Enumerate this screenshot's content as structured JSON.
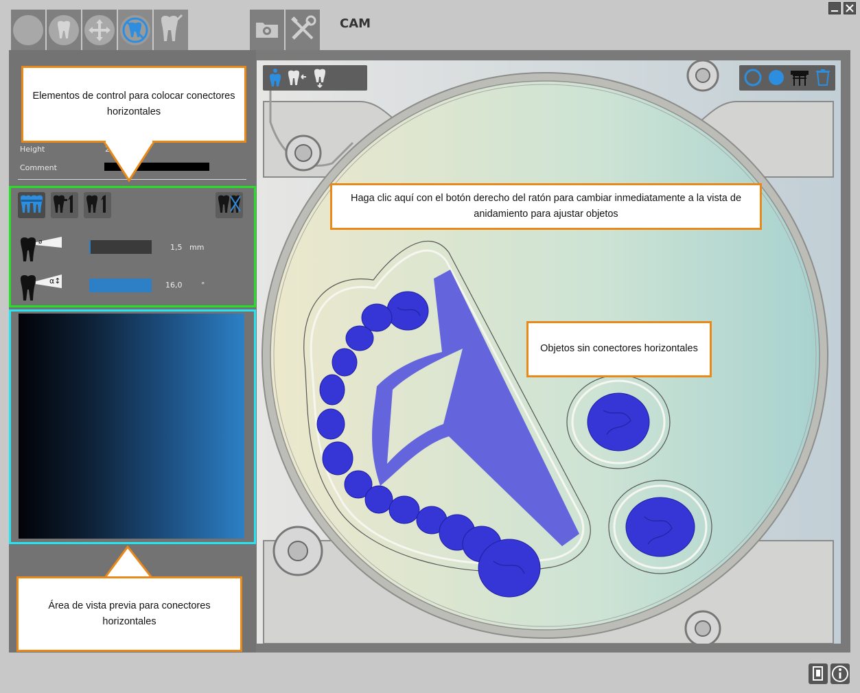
{
  "app": {
    "title": "CAM"
  },
  "toolbar": {
    "tabs": [
      {
        "icon": "circle-icon"
      },
      {
        "icon": "tooth-icon"
      },
      {
        "icon": "move-arrows-icon"
      },
      {
        "icon": "tooth-connector-icon",
        "active": true
      },
      {
        "icon": "tooth-brush-icon"
      }
    ],
    "extra": [
      {
        "icon": "settings-folder-icon"
      },
      {
        "icon": "tools-icon"
      }
    ]
  },
  "properties": {
    "height_label": "Height",
    "height_value": "20",
    "comment_label": "Comment"
  },
  "connector_controls": {
    "buttons": [
      {
        "icon": "connector-all-icon",
        "active": true
      },
      {
        "icon": "connector-single-icon"
      },
      {
        "icon": "connector-single-alt-icon"
      },
      {
        "icon": "connector-delete-icon"
      }
    ],
    "diameter": {
      "value": "1,5",
      "unit": "mm",
      "icon": "tooth-diameter-icon",
      "level": 0.0
    },
    "angle": {
      "value": "16,0",
      "unit": "°",
      "icon": "tooth-angle-icon",
      "level": 1.0
    }
  },
  "viewport_toolbar": {
    "left": [
      "view-person-icon",
      "view-tooth-arrow-icon",
      "view-tooth-down-icon"
    ],
    "right": [
      "ring-icon",
      "disc-icon",
      "support-icon",
      "trash-icon"
    ]
  },
  "callouts": {
    "controls": "Elementos de control para colocar conectores horizontales",
    "right_click": "Haga clic aquí con el botón derecho del ratón para cambiar inmediatamente a la vista de anidamiento para ajustar objetos",
    "objects": "Objetos sin conectores horizontales",
    "preview": "Área de vista previa para conectores horizontales"
  },
  "bottom_icons": [
    "document-icon",
    "info-icon"
  ],
  "colors": {
    "accent": "#2d80c6",
    "callout_border": "#e8891a",
    "controls_frame": "#26e026",
    "preview_frame": "#25e6f0",
    "model": "#3838d8"
  }
}
